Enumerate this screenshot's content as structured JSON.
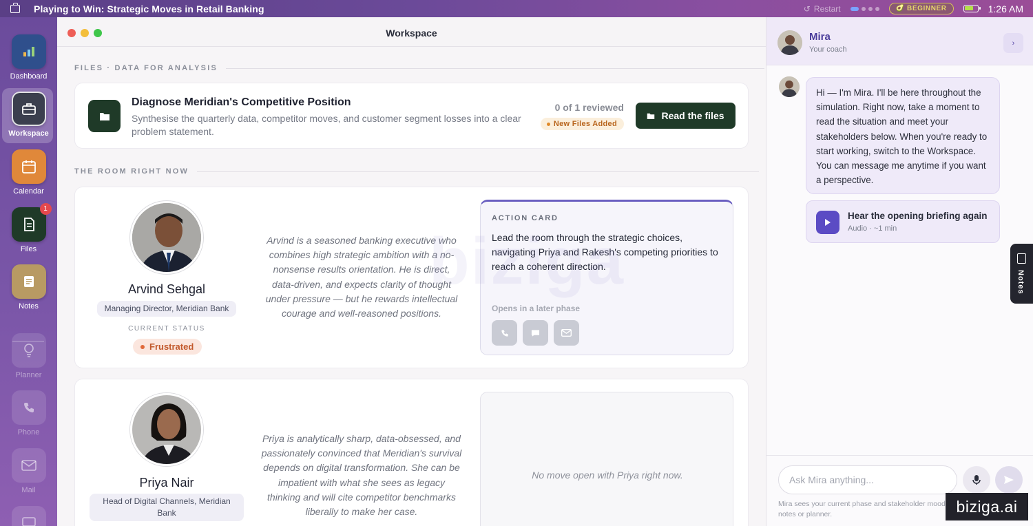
{
  "app": {
    "title": "Playing to Win: Strategic Moves in Retail Banking",
    "restart_label": "Restart",
    "level_label": "BEGINNER",
    "time": "1:26 AM"
  },
  "sidebar": {
    "items": [
      {
        "label": "Dashboard",
        "icon": "bar-chart-icon"
      },
      {
        "label": "Workspace",
        "icon": "briefcase-icon"
      },
      {
        "label": "Calendar",
        "icon": "calendar-icon"
      },
      {
        "label": "Files",
        "icon": "file-icon",
        "badge": "1"
      },
      {
        "label": "Notes",
        "icon": "notes-icon"
      },
      {
        "label": "Planner",
        "icon": "lightbulb-icon"
      },
      {
        "label": "Phone",
        "icon": "phone-icon"
      },
      {
        "label": "Mail",
        "icon": "mail-icon"
      }
    ]
  },
  "workspace": {
    "title": "Workspace",
    "files_section": "FILES · DATA FOR ANALYSIS",
    "file_card": {
      "title": "Diagnose Meridian's Competitive Position",
      "description": "Synthesise the quarterly data, competitor moves, and customer segment losses into a clear problem statement.",
      "reviewed": "0 of 1 reviewed",
      "new_badge": "New Files Added",
      "button": "Read the files"
    },
    "room_section": "THE ROOM RIGHT NOW",
    "stakeholders": [
      {
        "name": "Arvind Sehgal",
        "role": "Managing Director, Meridian Bank",
        "status_label": "CURRENT STATUS",
        "status": "Frustrated",
        "description": "Arvind is a seasoned banking executive who combines high strategic ambition with a no-nonsense results orientation. He is direct, data-driven, and expects clarity of thought under pressure — but he rewards intellectual courage and well-reasoned positions.",
        "action_card": {
          "heading": "ACTION CARD",
          "body": "Lead the room through the strategic choices, navigating Priya and Rakesh's competing priorities to reach a coherent direction.",
          "opens": "Opens in a later phase"
        }
      },
      {
        "name": "Priya Nair",
        "role": "Head of Digital Channels, Meridian Bank",
        "description": "Priya is analytically sharp, data-obsessed, and passionately convinced that Meridian's survival depends on digital transformation. She can be impatient with what she sees as legacy thinking and will cite competitor benchmarks liberally to make her case.",
        "empty_text": "No move open with Priya right now."
      }
    ],
    "watermark": "biziga"
  },
  "coach": {
    "name": "Mira",
    "subtitle": "Your coach",
    "message": "Hi — I'm Mira. I'll be here throughout the simulation. Right now, take a moment to read the situation and meet your stakeholders below. When you're ready to start working, switch to the Workspace. You can message me anytime if you want a perspective.",
    "audio_title": "Hear the opening briefing again",
    "audio_sub": "Audio · ~1 min",
    "input_placeholder": "Ask Mira anything...",
    "foot_note": "Mira sees your current phase and stakeholder moods. She notes or planner."
  },
  "notes_tab": "Notes",
  "brand": "biziga.ai",
  "colors": {
    "accent": "#5b4bc4",
    "dark_green": "#1f3a28",
    "sidebar": "#7a56a8",
    "frustrated": "#c2592c"
  }
}
